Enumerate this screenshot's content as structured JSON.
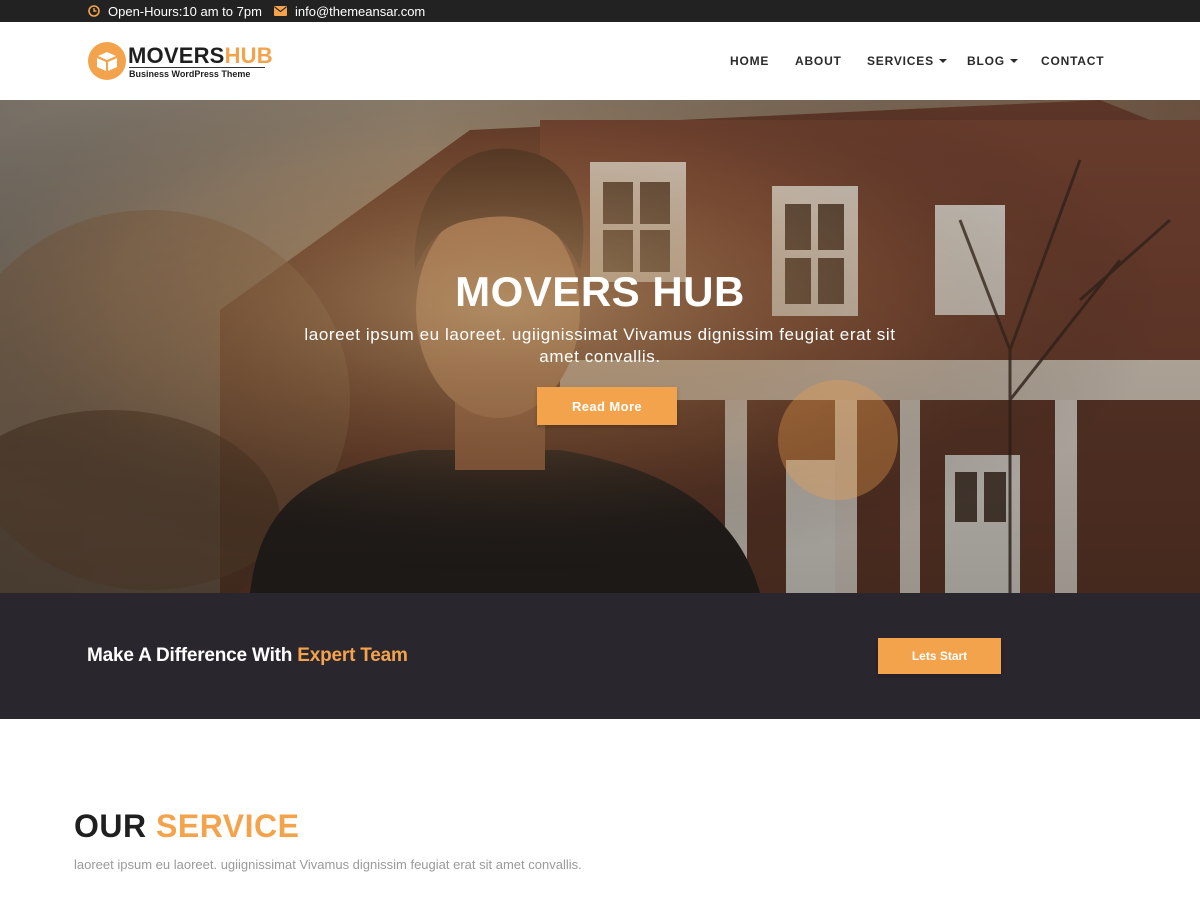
{
  "topbar": {
    "hours": "Open-Hours:10 am to 7pm",
    "email": "info@themeansar.com"
  },
  "logo": {
    "word_a": "MOVERS",
    "word_b": "HUB",
    "tagline": "Business WordPress Theme"
  },
  "nav": {
    "items": [
      "HOME",
      "ABOUT",
      "SERVICES",
      "BLOG",
      "CONTACT"
    ]
  },
  "hero": {
    "title": "MOVERS HUB",
    "subtitle": "laoreet ipsum eu laoreet. ugiignissimat Vivamus dignissim feugiat erat sit amet convallis.",
    "button": "Read More"
  },
  "cta": {
    "text_a": "Make A Difference With ",
    "text_b": "Expert Team",
    "button": "Lets Start"
  },
  "service": {
    "title_a": "OUR ",
    "title_b": "SERVICE",
    "subtitle": "laoreet ipsum eu laoreet. ugiignissimat Vivamus dignissim feugiat erat sit amet convallis."
  },
  "colors": {
    "accent": "#f4a34d",
    "dark": "#29272d",
    "topbar": "#222222"
  },
  "icons": [
    "clock-icon",
    "mail-icon",
    "logo-box-icon"
  ]
}
